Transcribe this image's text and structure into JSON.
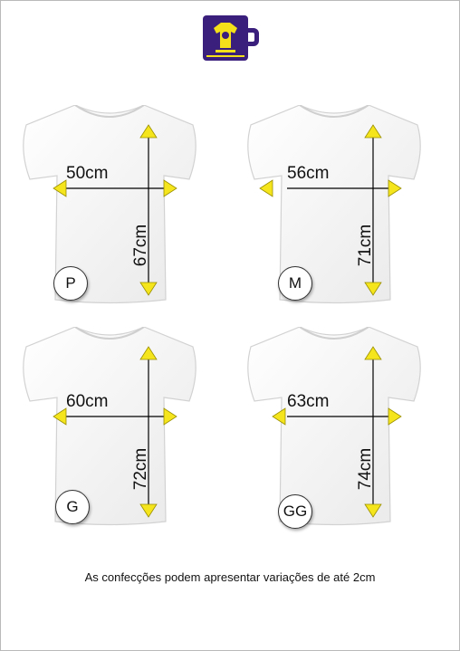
{
  "brand": {
    "logo_icon": "mug-shirt-logo-icon",
    "colors": {
      "primary": "#3b1f7c",
      "accent": "#f3df1a"
    }
  },
  "arrow_color": "#f4e51c",
  "sizes": [
    {
      "size": "P",
      "width": "50cm",
      "length": "67cm"
    },
    {
      "size": "M",
      "width": "56cm",
      "length": "71cm"
    },
    {
      "size": "G",
      "width": "60cm",
      "length": "72cm"
    },
    {
      "size": "GG",
      "width": "63cm",
      "length": "74cm"
    }
  ],
  "note": "As confecções podem apresentar variações de até 2cm"
}
